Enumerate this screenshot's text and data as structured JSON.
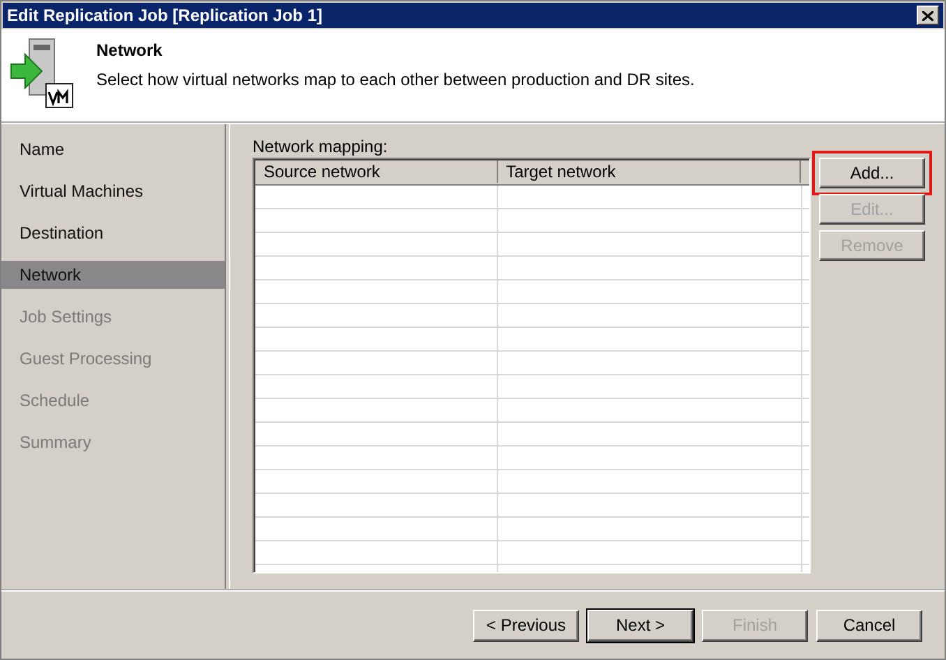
{
  "window": {
    "title": "Edit Replication Job [Replication Job 1]"
  },
  "header": {
    "title": "Network",
    "description": "Select how virtual networks map to each other between production and DR sites."
  },
  "steps": [
    {
      "label": "Name",
      "selected": false,
      "disabled": false
    },
    {
      "label": "Virtual Machines",
      "selected": false,
      "disabled": false
    },
    {
      "label": "Destination",
      "selected": false,
      "disabled": false
    },
    {
      "label": "Network",
      "selected": true,
      "disabled": false
    },
    {
      "label": "Job Settings",
      "selected": false,
      "disabled": true
    },
    {
      "label": "Guest Processing",
      "selected": false,
      "disabled": true
    },
    {
      "label": "Schedule",
      "selected": false,
      "disabled": true
    },
    {
      "label": "Summary",
      "selected": false,
      "disabled": true
    }
  ],
  "mapping": {
    "label": "Network mapping:",
    "columns": [
      "Source network",
      "Target network"
    ]
  },
  "side_buttons": [
    {
      "label": "Add...",
      "disabled": false,
      "highlighted": true
    },
    {
      "label": "Edit...",
      "disabled": true,
      "highlighted": false
    },
    {
      "label": "Remove",
      "disabled": true,
      "highlighted": false
    }
  ],
  "footer_buttons": [
    {
      "label": "< Previous",
      "disabled": false,
      "default": false
    },
    {
      "label": "Next >",
      "disabled": false,
      "default": true
    },
    {
      "label": "Finish",
      "disabled": true,
      "default": false
    },
    {
      "label": "Cancel",
      "disabled": false,
      "default": false
    }
  ]
}
